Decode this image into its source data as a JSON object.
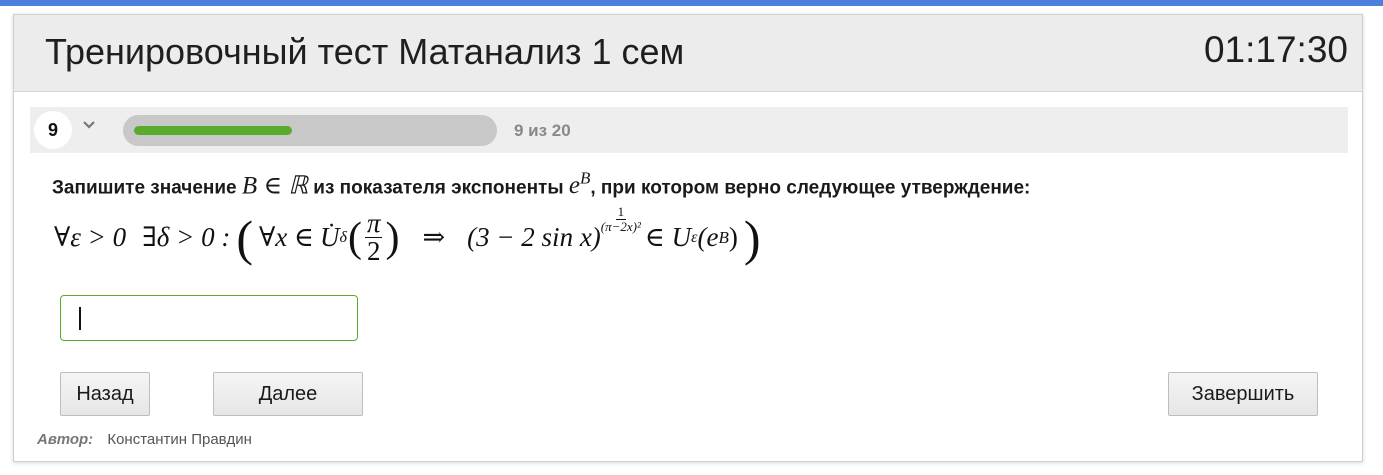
{
  "header": {
    "title": "Тренировочный тест Матанализ 1 сем",
    "timer": "01:17:30"
  },
  "navigation": {
    "question_number": "9",
    "progress_text": "9 из 20",
    "progress_fraction": 0.45
  },
  "question": {
    "text_part1": "Запишите значение",
    "math1": "B ∈ ℝ",
    "text_part2": "из показателя экспоненты",
    "math2_base": "e",
    "math2_exp": "B",
    "text_part3": ", при котором верно следующее утверждение:"
  },
  "formula": {
    "quant1": "∀ε > 0",
    "quant2": "∃δ > 0 :",
    "lparen": "(",
    "forall_x": "∀x ∈",
    "U_dot": "U̇",
    "delta_sub": "δ",
    "inner_lparen": "(",
    "pi_num": "π",
    "pi_den": "2",
    "inner_rparen": ")",
    "implies": "⇒",
    "base": "(3 − 2 sin x)",
    "exp_num": "1",
    "exp_den": "(π−2x)²",
    "in_U": "∈ U",
    "eps_sub": "ε",
    "arg": "(e",
    "arg_exp": "B",
    "arg_close": ")",
    "rparen": ")"
  },
  "answer": {
    "value": "",
    "placeholder": ""
  },
  "buttons": {
    "back": "Назад",
    "next": "Далее",
    "finish": "Завершить"
  },
  "footer": {
    "author_label": "Автор:",
    "author_name": "Константин Правдин"
  },
  "colors": {
    "top_accent": "#4a7fde",
    "progress_fill": "#5aaa2c",
    "input_border": "#5aaa2c"
  }
}
